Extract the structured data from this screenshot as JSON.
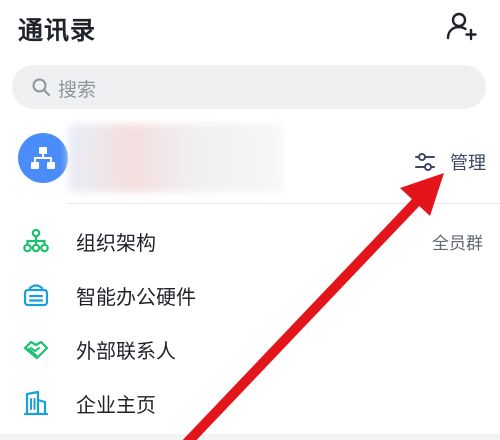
{
  "header": {
    "title": "通讯录",
    "add_icon": "add-user-icon"
  },
  "search": {
    "placeholder": "搜索",
    "icon": "search-icon"
  },
  "org_card": {
    "manage_label": "管理",
    "avatar_icon": "org-chart-icon",
    "manage_icon": "sliders-icon"
  },
  "menu": [
    {
      "label": "组织架构",
      "icon": "org-structure-icon",
      "badge": "全员群"
    },
    {
      "label": "智能办公硬件",
      "icon": "smart-hardware-icon"
    },
    {
      "label": "外部联系人",
      "icon": "handshake-icon"
    },
    {
      "label": "企业主页",
      "icon": "building-icon"
    }
  ],
  "colors": {
    "accent_blue": "#4a8df9",
    "icon_green": "#18c26e",
    "icon_cyan": "#18a0d8",
    "arrow_red": "#e3151b"
  }
}
